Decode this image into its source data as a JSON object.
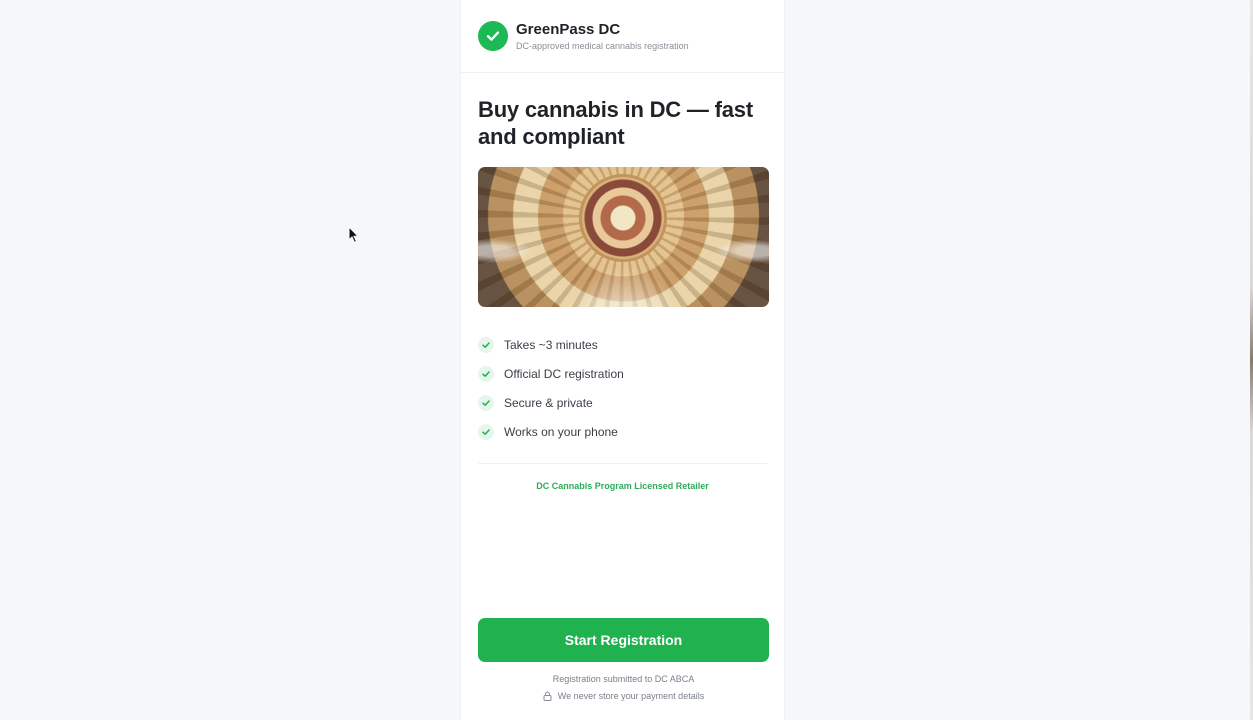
{
  "brand": {
    "name": "GreenPass DC",
    "tagline": "DC-approved medical cannabis registration"
  },
  "hero": {
    "headline": "Buy cannabis in DC — fast and compliant",
    "image_alt": "Capitol rotunda dome interior"
  },
  "features": [
    {
      "label": "Takes ~3 minutes",
      "icon": "check-icon"
    },
    {
      "label": "Official DC registration",
      "icon": "check-icon"
    },
    {
      "label": "Secure & private",
      "icon": "check-icon"
    },
    {
      "label": "Works on your phone",
      "icon": "check-icon"
    }
  ],
  "retailer_label": "DC Cannabis Program Licensed Retailer",
  "cta": {
    "label": "Start Registration"
  },
  "footer": {
    "submitted_note": "Registration submitted to DC ABCA",
    "privacy_note": "We never store your payment details",
    "privacy_icon": "lock-icon"
  },
  "colors": {
    "accent": "#1fb24f",
    "accent_light": "#e6f6ec",
    "background": "#f6f7f9",
    "text": "#1f2328"
  }
}
